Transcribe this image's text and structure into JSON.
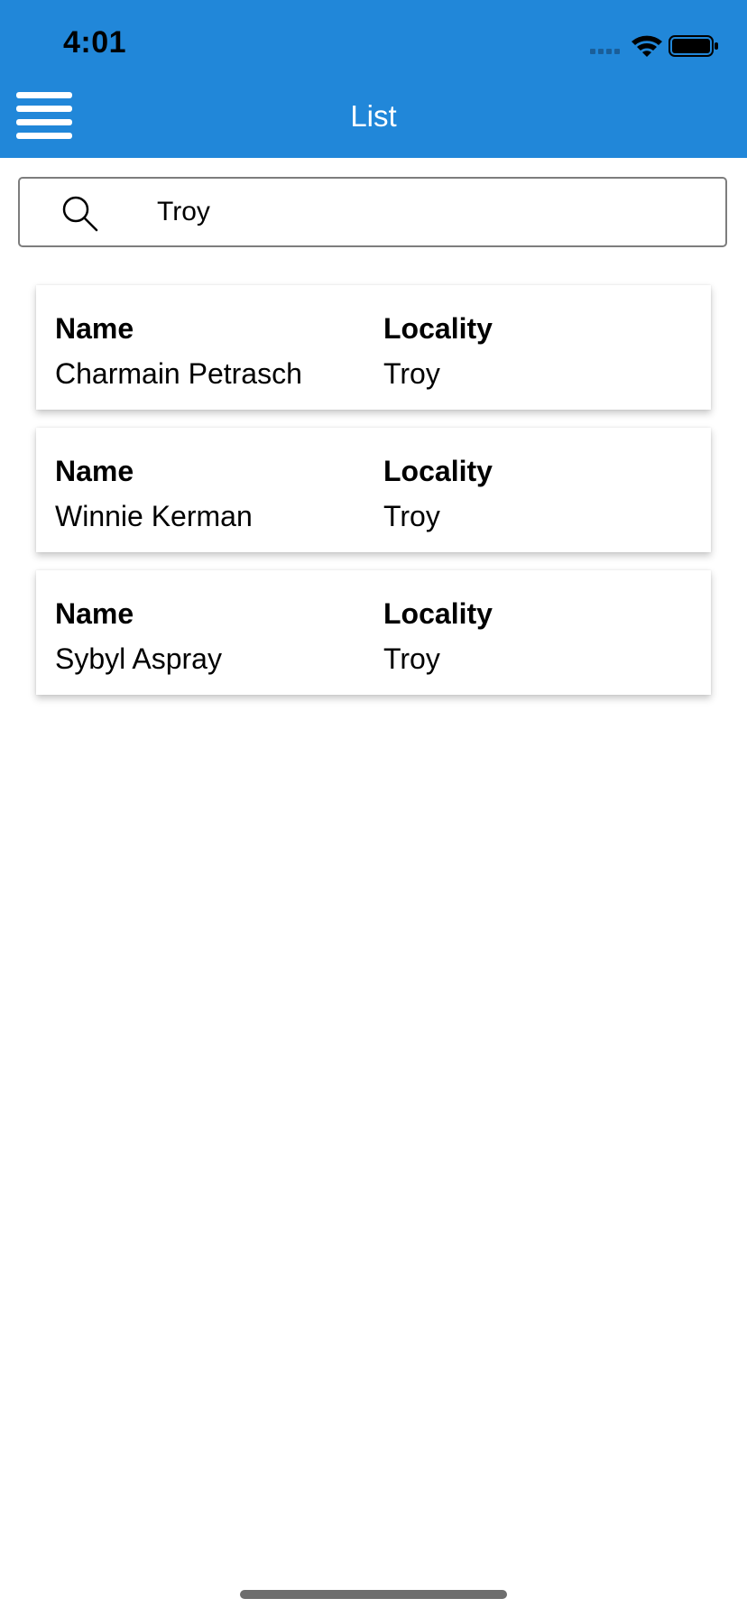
{
  "status_bar": {
    "time": "4:01",
    "icons": [
      "cellular-signal-icon",
      "wifi-icon",
      "battery-icon"
    ]
  },
  "header": {
    "title": "List",
    "menu_icon": "hamburger-menu-icon",
    "background_color": "#2187d9"
  },
  "search": {
    "value": "Troy",
    "icon": "search-icon"
  },
  "results": [
    {
      "name_label": "Name",
      "name": "Charmain Petrasch",
      "locality_label": "Locality",
      "locality": "Troy"
    },
    {
      "name_label": "Name",
      "name": "Winnie Kerman",
      "locality_label": "Locality",
      "locality": "Troy"
    },
    {
      "name_label": "Name",
      "name": "Sybyl Aspray",
      "locality_label": "Locality",
      "locality": "Troy"
    }
  ]
}
